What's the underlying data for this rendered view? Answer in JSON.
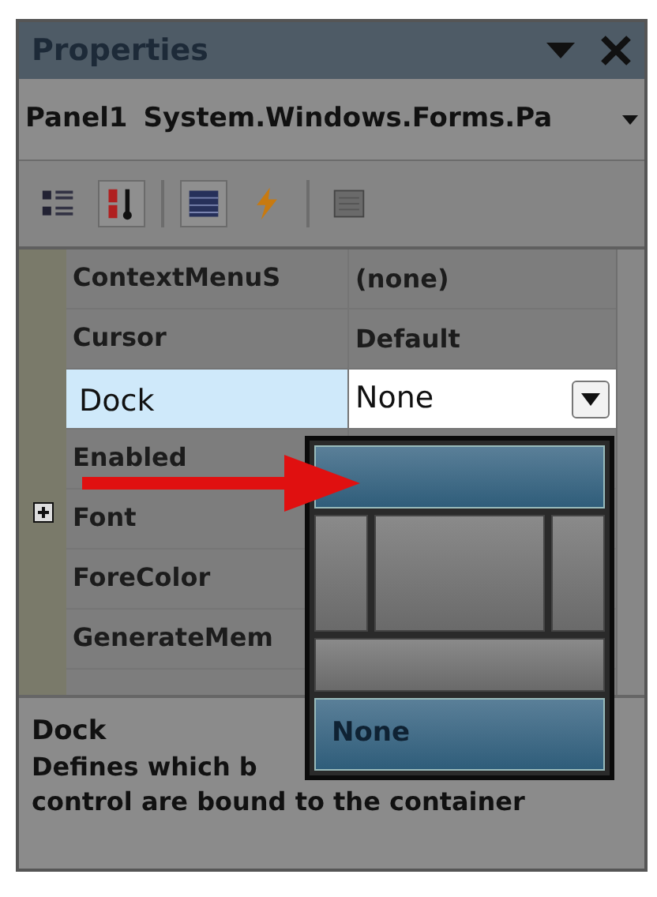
{
  "window": {
    "title": "Properties"
  },
  "object_selector": {
    "name": "Panel1",
    "type": "System.Windows.Forms.Pa"
  },
  "toolbar": [
    {
      "kind": "categorized",
      "selected": false
    },
    {
      "kind": "alphabetical",
      "selected": true
    },
    {
      "kind": "properties",
      "selected": true
    },
    {
      "kind": "events",
      "selected": false
    },
    {
      "kind": "pages",
      "selected": false
    }
  ],
  "properties": [
    {
      "name": "ContextMenuS",
      "value": "(none)",
      "selected": false,
      "expandable": false
    },
    {
      "name": "Cursor",
      "value": "Default",
      "selected": false,
      "expandable": false
    },
    {
      "name": "Dock",
      "value": "None",
      "selected": true,
      "expandable": false
    },
    {
      "name": "Enabled",
      "selected": false,
      "expandable": false
    },
    {
      "name": "Font",
      "selected": false,
      "expandable": true
    },
    {
      "name": "ForeColor",
      "selected": false,
      "expandable": false
    },
    {
      "name": "GenerateMem",
      "selected": false,
      "expandable": false
    }
  ],
  "dock_editor": {
    "options": [
      {
        "kind": "top",
        "highlighted": true
      },
      {
        "kind": "left",
        "highlighted": false
      },
      {
        "kind": "fill",
        "highlighted": false
      },
      {
        "kind": "right",
        "highlighted": false
      },
      {
        "kind": "bottom",
        "highlighted": false
      },
      {
        "kind": "none",
        "label": "None",
        "highlighted": true
      }
    ]
  },
  "description": {
    "title": "Dock",
    "lines": [
      "Defines which b",
      "control are bound to the container"
    ]
  }
}
